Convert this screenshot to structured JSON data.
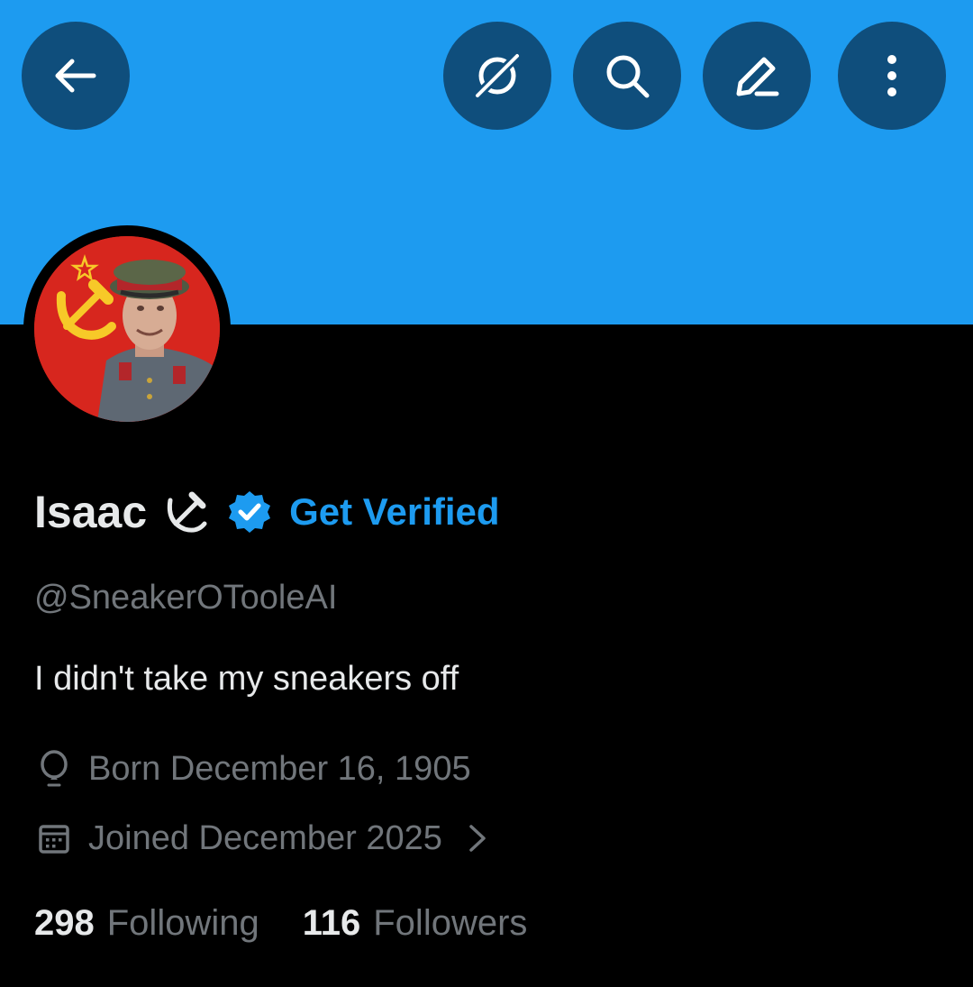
{
  "header": {
    "back_button": "back-arrow-icon",
    "actions": [
      "grok-icon",
      "search-icon",
      "edit-icon",
      "more-vertical-icon"
    ]
  },
  "colors": {
    "banner": "#1d9bf0",
    "button_bg": "#0f4e7c",
    "accent": "#1d9bf0",
    "text_primary": "#e7e9ea",
    "text_secondary": "#71767b"
  },
  "profile": {
    "display_name": "Isaac",
    "name_emoji": "☭",
    "verified": true,
    "get_verified_label": "Get Verified",
    "handle": "@SneakerOTooleAI",
    "bio": "I didn't take my sneakers off",
    "born": "Born December 16, 1905",
    "joined": "Joined December 2025"
  },
  "stats": {
    "following_count": "298",
    "following_label": "Following",
    "followers_count": "116",
    "followers_label": "Followers"
  }
}
